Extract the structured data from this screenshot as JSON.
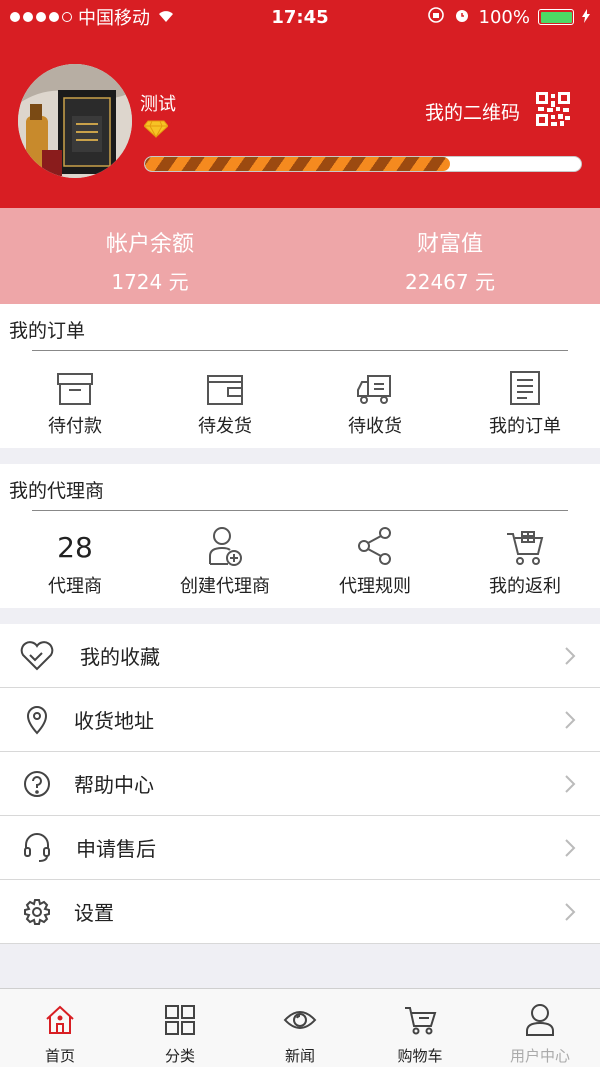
{
  "status_bar": {
    "carrier": "中国移动",
    "time": "17:45",
    "battery": "100%"
  },
  "profile": {
    "username": "测试",
    "qr_label": "我的二维码",
    "level_progress": 0.7
  },
  "account": {
    "balance_label": "帐户余额",
    "balance_value": "1724 元",
    "wealth_label": "财富值",
    "wealth_value": "22467 元"
  },
  "orders": {
    "title": "我的订单",
    "items": [
      {
        "label": "待付款",
        "icon": "pending-payment-icon"
      },
      {
        "label": "待发货",
        "icon": "pending-shipment-icon"
      },
      {
        "label": "待收货",
        "icon": "delivery-truck-icon"
      },
      {
        "label": "我的订单",
        "icon": "order-list-icon"
      }
    ]
  },
  "agents": {
    "title": "我的代理商",
    "count": "28",
    "items": [
      {
        "label": "代理商"
      },
      {
        "label": "创建代理商",
        "icon": "add-user-icon"
      },
      {
        "label": "代理规则",
        "icon": "share-nodes-icon"
      },
      {
        "label": "我的返利",
        "icon": "cart-gift-icon"
      }
    ]
  },
  "menu": [
    {
      "label": "我的收藏",
      "icon": "heart-icon"
    },
    {
      "label": "收货地址",
      "icon": "location-pin-icon"
    },
    {
      "label": "帮助中心",
      "icon": "help-circle-icon"
    },
    {
      "label": "申请售后",
      "icon": "headset-icon"
    },
    {
      "label": "设置",
      "icon": "gear-icon"
    }
  ],
  "tabbar": [
    {
      "label": "首页",
      "icon": "home-icon"
    },
    {
      "label": "分类",
      "icon": "grid-icon"
    },
    {
      "label": "新闻",
      "icon": "eye-icon"
    },
    {
      "label": "购物车",
      "icon": "cart-icon"
    },
    {
      "label": "用户中心",
      "icon": "user-icon"
    }
  ],
  "colors": {
    "brand_red": "#d81e23",
    "balance_bg": "#eea6a8",
    "progress_orange": "#f58a1f"
  }
}
